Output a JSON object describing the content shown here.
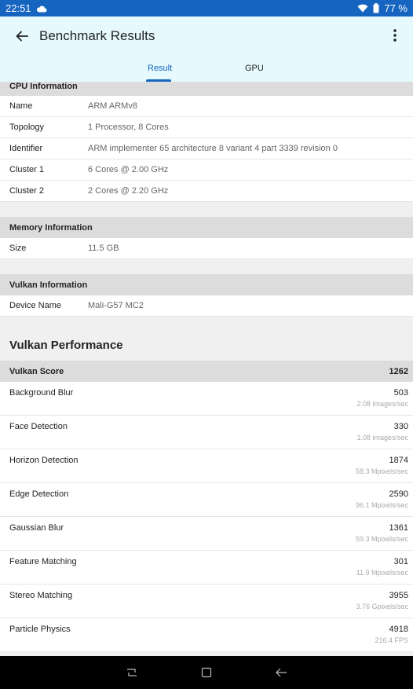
{
  "status": {
    "time": "22:51",
    "battery": "77 %"
  },
  "appbar": {
    "title": "Benchmark Results"
  },
  "tabs": [
    {
      "label": "Result",
      "active": true
    },
    {
      "label": "GPU",
      "active": false
    }
  ],
  "cpu": {
    "header": "CPU Information",
    "rows": [
      {
        "key": "Name",
        "value": "ARM ARMv8"
      },
      {
        "key": "Topology",
        "value": "1 Processor, 8 Cores"
      },
      {
        "key": "Identifier",
        "value": "ARM implementer 65 architecture 8 variant 4 part 3339 revision 0"
      },
      {
        "key": "Cluster 1",
        "value": "6 Cores @ 2.00 GHz"
      },
      {
        "key": "Cluster 2",
        "value": "2 Cores @ 2.20 GHz"
      }
    ]
  },
  "memory": {
    "header": "Memory Information",
    "rows": [
      {
        "key": "Size",
        "value": "11.5 GB"
      }
    ]
  },
  "vulkan": {
    "header": "Vulkan Information",
    "rows": [
      {
        "key": "Device Name",
        "value": "Mali-G57 MC2"
      }
    ]
  },
  "performance": {
    "title": "Vulkan Performance",
    "score_label": "Vulkan Score",
    "score_value": "1262",
    "rows": [
      {
        "name": "Background Blur",
        "score": "503",
        "rate": "2.08 images/sec"
      },
      {
        "name": "Face Detection",
        "score": "330",
        "rate": "1.08 images/sec"
      },
      {
        "name": "Horizon Detection",
        "score": "1874",
        "rate": "58.3 Mpixels/sec"
      },
      {
        "name": "Edge Detection",
        "score": "2590",
        "rate": "96.1 Mpixels/sec"
      },
      {
        "name": "Gaussian Blur",
        "score": "1361",
        "rate": "59.3 Mpixels/sec"
      },
      {
        "name": "Feature Matching",
        "score": "301",
        "rate": "11.9 Mpixels/sec"
      },
      {
        "name": "Stereo Matching",
        "score": "3955",
        "rate": "3.76 Gpixels/sec"
      },
      {
        "name": "Particle Physics",
        "score": "4918",
        "rate": "216.4 FPS"
      }
    ]
  },
  "icons": {
    "status": [
      "cloud-icon",
      "wifi-icon",
      "battery-icon"
    ],
    "appbar": [
      "back-arrow-icon",
      "more-vert-icon"
    ],
    "nav": [
      "recents-icon",
      "home-icon",
      "back-icon"
    ]
  },
  "colors": {
    "accent": "#1565c0",
    "appbar_bg": "#e6fafd",
    "section_bg": "#dcdcdc"
  }
}
